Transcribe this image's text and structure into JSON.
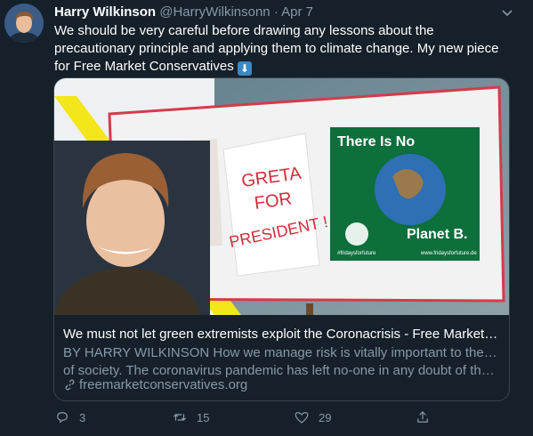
{
  "tweet": {
    "author_name": "Harry Wilkinson",
    "author_handle": "@HarryWilkinsonn",
    "separator": "·",
    "date": "Apr 7",
    "text": "We should be very careful before drawing any lessons about the precautionary principle and applying them to climate change. My new piece for Free Market Conservatives",
    "emoji": "⬇"
  },
  "card": {
    "title": "We must not let green extremists exploit the Coronacrisis - Free Market Conser...",
    "description_line1": "BY HARRY WILKINSON How we manage risk is vitally important to the wellbeing",
    "description_line2": "of society. The coronavirus pandemic has left no-one in any doubt of that. It is ...",
    "domain": "freemarketconservatives.org",
    "sign_text": [
      "GRETA",
      "FOR",
      "PRESIDENT !"
    ],
    "poster_top": "There Is No",
    "poster_bottom": "Planet B.",
    "poster_hashtag": "#fridaysforfuture",
    "poster_url": "www.fridaysforfuture.de"
  },
  "actions": {
    "replies": "3",
    "retweets": "15",
    "likes": "29"
  },
  "colors": {
    "background": "#15202b",
    "muted": "#8899a6",
    "border": "#38444d"
  }
}
